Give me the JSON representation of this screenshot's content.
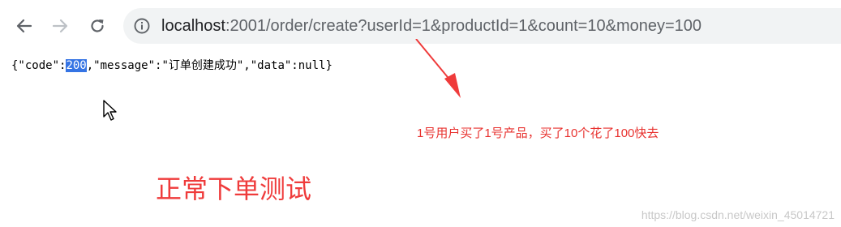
{
  "browser": {
    "url_host": "localhost",
    "url_path": ":2001/order/create?userId=1&productId=1&count=10&money=100"
  },
  "response": {
    "part1": "{\"code\":",
    "selected": "200",
    "part2": ",\"message\":\"订单创建成功\",\"data\":null}"
  },
  "annotations": {
    "note": "1号用户买了1号产品，买了10个花了100快去",
    "title": "正常下单测试",
    "accent_color": "#e8322f"
  },
  "watermark": "https://blog.csdn.net/weixin_45014721"
}
